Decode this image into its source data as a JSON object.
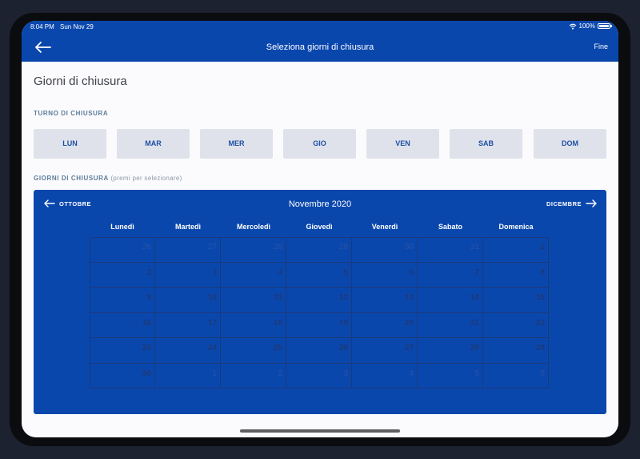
{
  "status_bar": {
    "time": "8:04 PM",
    "date": "Sun Nov 29",
    "battery": "100%"
  },
  "nav": {
    "title": "Seleziona giorni di chiusura",
    "done_label": "Fine",
    "back_icon": "arrow-left-icon"
  },
  "page_title": "Giorni di chiusura",
  "closing_shift": {
    "label": "TURNO DI CHIUSURA",
    "days": [
      "LUN",
      "MAR",
      "MER",
      "GIO",
      "VEN",
      "SAB",
      "DOM"
    ]
  },
  "closing_days": {
    "label": "GIORNI DI CHIUSURA",
    "hint": "(premi per selezionare)"
  },
  "calendar": {
    "prev_label": "OTTOBRE",
    "next_label": "DICEMBRE",
    "month_title": "Novembre 2020",
    "weekdays": [
      "Lunedì",
      "Martedì",
      "Mercoledì",
      "Giovedì",
      "Venerdì",
      "Sabato",
      "Domenica"
    ],
    "weeks": [
      [
        "26",
        "27",
        "28",
        "29",
        "30",
        "31",
        "1"
      ],
      [
        "2",
        "3",
        "4",
        "5",
        "6",
        "7",
        "8"
      ],
      [
        "9",
        "10",
        "11",
        "12",
        "13",
        "14",
        "15"
      ],
      [
        "16",
        "17",
        "18",
        "19",
        "20",
        "21",
        "22"
      ],
      [
        "23",
        "24",
        "25",
        "26",
        "27",
        "28",
        "29"
      ],
      [
        "30",
        "1",
        "2",
        "3",
        "4",
        "5",
        "6"
      ]
    ],
    "outside_month": [
      [
        true,
        true,
        true,
        true,
        true,
        true,
        false
      ],
      [
        false,
        false,
        false,
        false,
        false,
        false,
        false
      ],
      [
        false,
        false,
        false,
        false,
        false,
        false,
        false
      ],
      [
        false,
        false,
        false,
        false,
        false,
        false,
        false
      ],
      [
        false,
        false,
        false,
        false,
        false,
        false,
        false
      ],
      [
        false,
        true,
        true,
        true,
        true,
        true,
        true
      ]
    ]
  },
  "colors": {
    "accent": "#0a47ad",
    "day_button_bg": "#dfe2ea",
    "day_button_text": "#1d4fa6"
  }
}
